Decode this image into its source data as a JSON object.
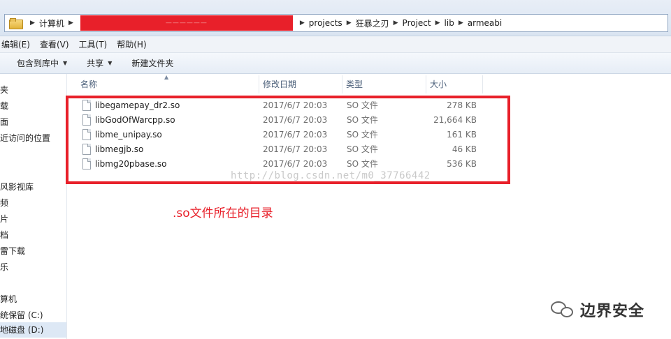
{
  "address": {
    "breadcrumb_before": [
      "计算机"
    ],
    "redacted_text": "——————",
    "breadcrumb_after": [
      "projects",
      "狂暴之刃",
      "Project",
      "lib",
      "armeabi"
    ]
  },
  "menu": [
    "编辑(E)",
    "查看(V)",
    "工具(T)",
    "帮助(H)"
  ],
  "toolbar": {
    "include_library": "包含到库中",
    "share": "共享",
    "new_folder": "新建文件夹"
  },
  "nav": [
    "夹",
    "载",
    "面",
    "近访问的位置",
    "风影视库",
    "频",
    "片",
    "档",
    "雷下载",
    "乐",
    "算机",
    "统保留 (C:)",
    "地磁盘 (D:)"
  ],
  "columns": {
    "name": "名称",
    "modified": "修改日期",
    "type": "类型",
    "size": "大小"
  },
  "files": [
    {
      "name": "libegamepay_dr2.so",
      "modified": "2017/6/7 20:03",
      "type": "SO 文件",
      "size": "278 KB"
    },
    {
      "name": "libGodOfWarcpp.so",
      "modified": "2017/6/7 20:03",
      "type": "SO 文件",
      "size": "21,664 KB"
    },
    {
      "name": "libme_unipay.so",
      "modified": "2017/6/7 20:03",
      "type": "SO 文件",
      "size": "161 KB"
    },
    {
      "name": "libmegjb.so",
      "modified": "2017/6/7 20:03",
      "type": "SO 文件",
      "size": "46 KB"
    },
    {
      "name": "libmg20pbase.so",
      "modified": "2017/6/7 20:03",
      "type": "SO 文件",
      "size": "536 KB"
    }
  ],
  "watermark_url": "http://blog.csdn.net/m0_37766442",
  "annotation": ".so文件所在的目录",
  "wechat_label": "边界安全",
  "colors": {
    "highlight": "#e8202a",
    "annotation": "#e8202a"
  },
  "icons": {
    "folder": "folder-icon",
    "file": "file-icon",
    "wechat": "wechat-icon"
  }
}
